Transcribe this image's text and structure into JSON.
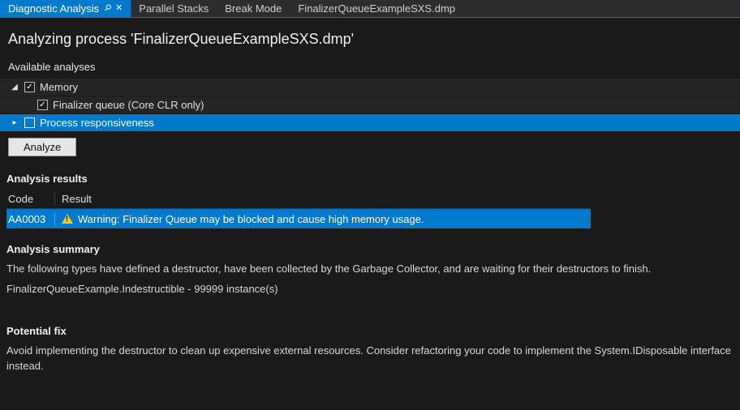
{
  "tabs": {
    "active": "Diagnostic Analysis",
    "others": [
      "Parallel Stacks",
      "Break Mode",
      "FinalizerQueueExampleSXS.dmp"
    ]
  },
  "title": "Analyzing process 'FinalizerQueueExampleSXS.dmp'",
  "available_label": "Available analyses",
  "tree": {
    "memory": {
      "label": "Memory",
      "checked": true,
      "expanded": true
    },
    "finalizer": {
      "label": "Finalizer queue (Core CLR only)",
      "checked": true
    },
    "responsiveness": {
      "label": "Process responsiveness",
      "checked": false,
      "expanded": false,
      "selected": true
    }
  },
  "analyze_button": "Analyze",
  "results_heading": "Analysis results",
  "results_cols": {
    "code": "Code",
    "result": "Result"
  },
  "results_rows": [
    {
      "code": "AA0003",
      "result": "Warning: Finalizer Queue may be blocked and cause high memory usage."
    }
  ],
  "summary_heading": "Analysis summary",
  "summary_line1": "The following types have defined a destructor, have been collected by the Garbage Collector, and are waiting for their destructors to finish.",
  "summary_line2": "FinalizerQueueExample.Indestructible - 99999 instance(s)",
  "fix_heading": "Potential fix",
  "fix_text": "Avoid implementing the destructor to clean up expensive external resources. Consider refactoring your code to implement the System.IDisposable interface instead."
}
